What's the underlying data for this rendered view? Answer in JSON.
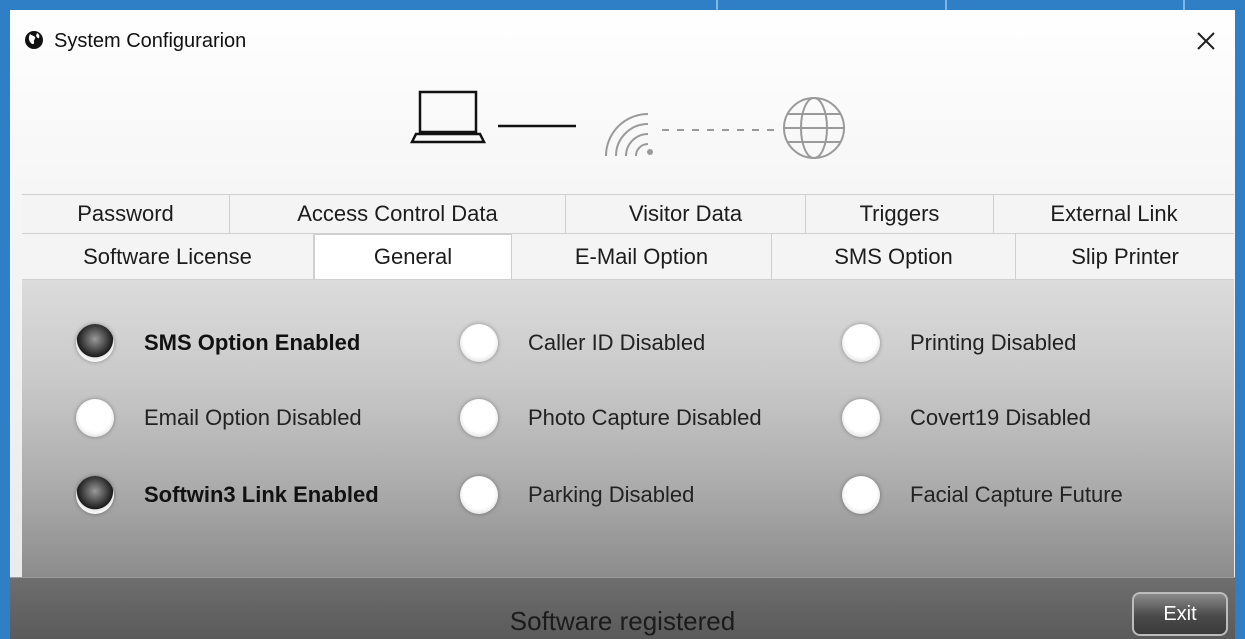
{
  "window": {
    "title": "System Configurarion",
    "app_icon": "globe-icon",
    "close_icon": "close-icon",
    "close_glyph": "✕"
  },
  "header_graphic": {
    "icons": [
      "laptop-icon",
      "wifi-icon",
      "globe-icon"
    ]
  },
  "tabs": {
    "row1": [
      "Password",
      "Access Control Data",
      "Visitor Data",
      "Triggers",
      "External Link"
    ],
    "row2": [
      "Software License",
      "General",
      "E-Mail Option",
      "SMS Option",
      "Slip Printer"
    ],
    "active": "General"
  },
  "options": {
    "col1": [
      {
        "label": "SMS Option Enabled",
        "selected": true
      },
      {
        "label": "Email Option Disabled",
        "selected": false
      },
      {
        "label": "Softwin3 Link Enabled",
        "selected": true
      }
    ],
    "col2": [
      {
        "label": "Caller ID Disabled",
        "selected": false
      },
      {
        "label": "Photo Capture Disabled",
        "selected": false
      },
      {
        "label": "Parking Disabled",
        "selected": false
      }
    ],
    "col3": [
      {
        "label": "Printing Disabled",
        "selected": false
      },
      {
        "label": "Covert19 Disabled",
        "selected": false
      },
      {
        "label": "Facial Capture Future",
        "selected": false
      }
    ]
  },
  "status": {
    "text": "Software registered",
    "exit_label": "Exit"
  },
  "colors": {
    "taskbar_blue": "#2f7fc7",
    "status_bar": "#5f5f5f"
  }
}
